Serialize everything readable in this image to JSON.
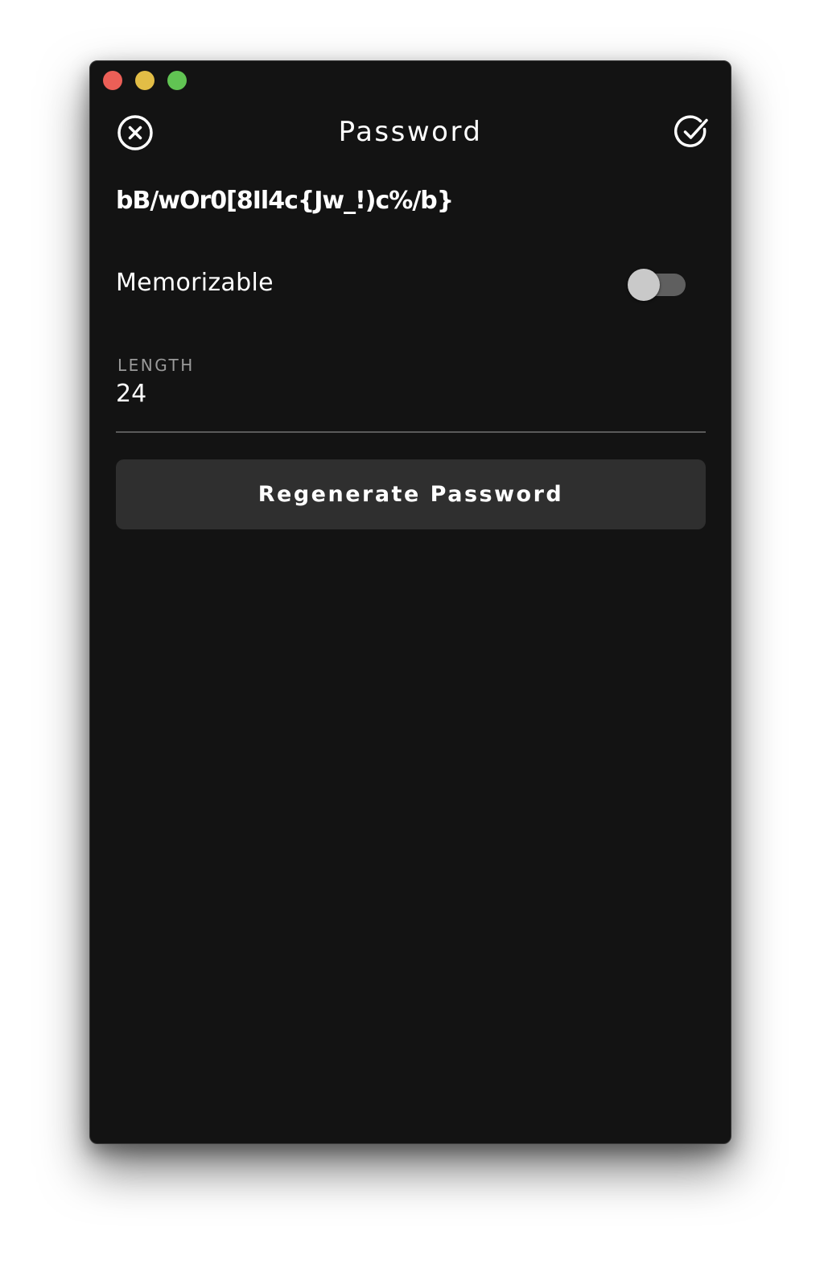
{
  "header": {
    "title": "Password",
    "close_icon": "close-circle-icon",
    "confirm_icon": "check-circle-icon"
  },
  "password": {
    "value": "bB/wOr0[8Il4c{Jw_!)c%/b}"
  },
  "options": {
    "memorizable_label": "Memorizable",
    "memorizable_enabled": false
  },
  "length": {
    "label": "LENGTH",
    "value": "24"
  },
  "actions": {
    "regenerate_label": "Regenerate Password"
  },
  "colors": {
    "background": "#131313",
    "text": "#ffffff",
    "muted_text": "#9a9a9a",
    "button_bg": "#2f2f2f",
    "traffic_red": "#ec5f57",
    "traffic_yellow": "#e2bd46",
    "traffic_green": "#61c453"
  }
}
